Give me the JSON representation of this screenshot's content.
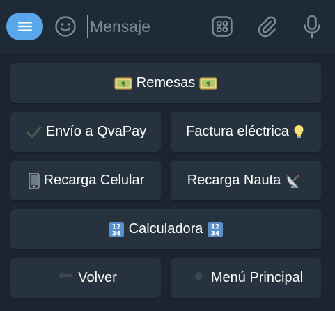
{
  "input_bar": {
    "placeholder": "Mensaje",
    "icons": [
      "menu-icon",
      "emoji-icon",
      "commands-icon",
      "attach-icon",
      "microphone-icon"
    ]
  },
  "keyboard": {
    "buttons": [
      {
        "label": "Remesas",
        "lead_icon": "money-icon",
        "trail_icon": "money-icon"
      },
      {
        "label": "Envío a QvaPay",
        "lead_icon": "check-icon"
      },
      {
        "label": "Factura eléctrica",
        "trail_icon": "lightbulb-icon"
      },
      {
        "label": "Recarga Celular",
        "lead_icon": "mobile-phone-icon"
      },
      {
        "label": "Recarga Nauta",
        "trail_icon": "satellite-dish-icon"
      },
      {
        "label": "Calculadora",
        "lead_icon": "numbers-1234-icon",
        "trail_icon": "numbers-1234-icon"
      },
      {
        "label": "Volver",
        "lead_icon": "back-arrow-icon"
      },
      {
        "label": "Menú Principal",
        "lead_icon": "top-arrow-icon"
      }
    ]
  },
  "colors": {
    "background": "#18212d",
    "input_bar": "#1f2a37",
    "button": "#27323f",
    "accent": "#5aa6ea",
    "icon_gray": "#7f8b97"
  }
}
